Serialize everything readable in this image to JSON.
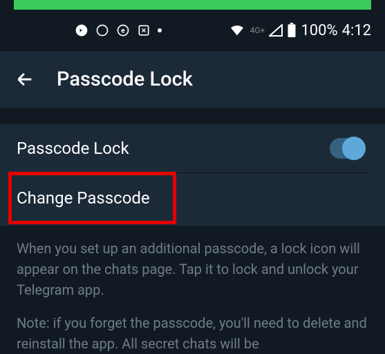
{
  "status": {
    "network_label": "4G+",
    "battery_percent": "100%",
    "time": "4:12"
  },
  "appbar": {
    "title": "Passcode Lock"
  },
  "settings": {
    "passcode_lock_label": "Passcode Lock",
    "passcode_lock_enabled": true,
    "change_passcode_label": "Change Passcode"
  },
  "description": {
    "p1": "When you set up an additional passcode, a lock icon will appear on the chats page. Tap it to lock and unlock your Telegram app.",
    "p2": "Note: if you forget the passcode, you'll need to delete and reinstall the app. All secret chats will be"
  }
}
